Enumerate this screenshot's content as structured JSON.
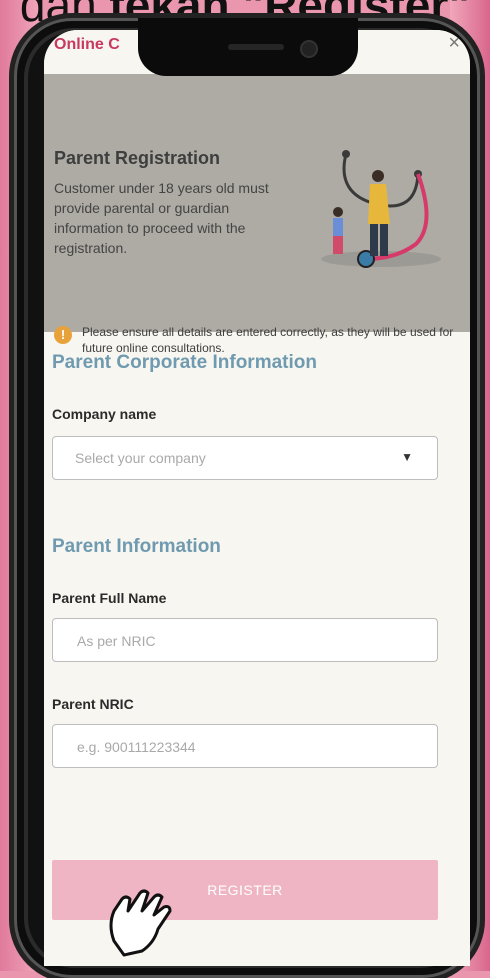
{
  "caption": {
    "normal": "dan ",
    "bold": "tekan \"Register\""
  },
  "header": {
    "title": "Online C",
    "close": "×"
  },
  "banner": {
    "title": "Parent Registration",
    "description": "Customer under 18 years old must provide parental or guardian information to proceed with the registration.",
    "note": "Please ensure all details are entered correctly, as they will be used for future online consultations.",
    "note_icon": "!"
  },
  "corporate": {
    "section_title": "Parent Corporate Information",
    "company_label": "Company name",
    "company_placeholder": "Select your company",
    "caret": "▼"
  },
  "parent": {
    "section_title": "Parent Information",
    "fullname_label": "Parent Full Name",
    "fullname_placeholder": "As per NRIC",
    "nric_label": "Parent NRIC",
    "nric_placeholder": "e.g. 900111223344"
  },
  "actions": {
    "register_label": "REGISTER"
  },
  "colors": {
    "accent": "#c8385f",
    "section": "#6f9ab0",
    "button": "#efb5c4",
    "banner": "#aeaba4"
  }
}
